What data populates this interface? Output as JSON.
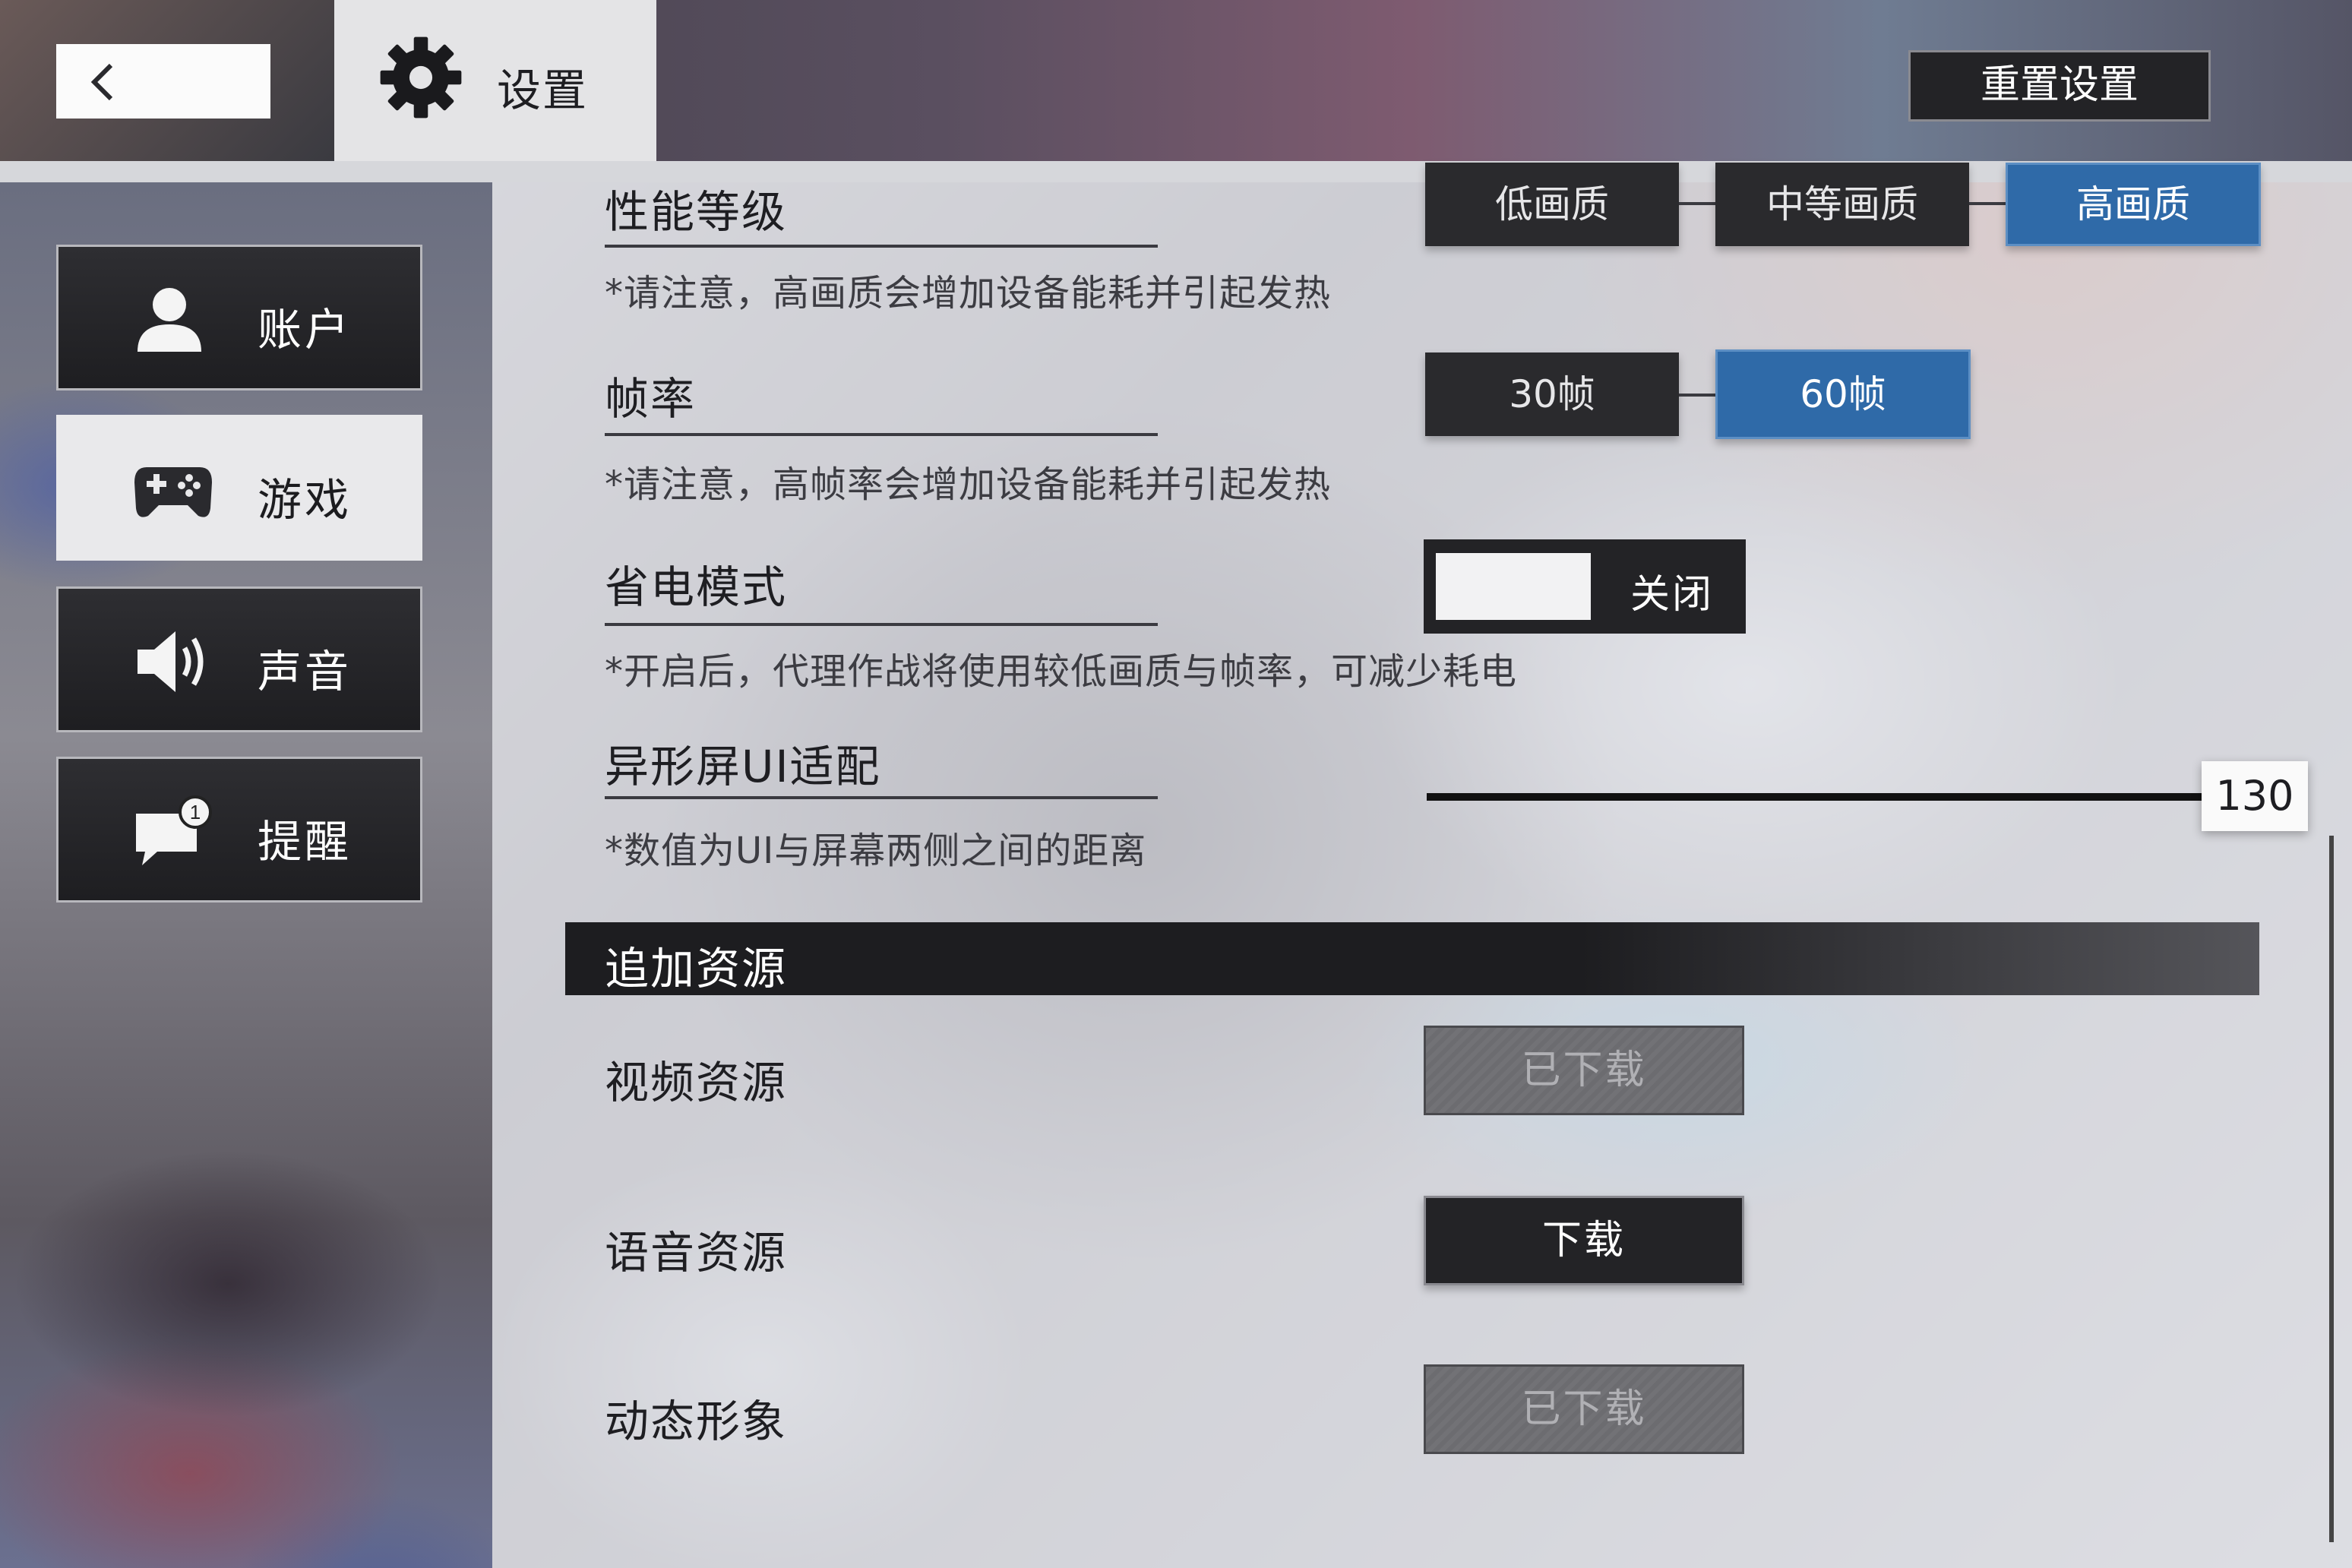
{
  "header": {
    "title": "设置",
    "reset_label": "重置设置"
  },
  "sidebar": {
    "items": [
      {
        "label": "账户",
        "icon": "user-icon",
        "active": false
      },
      {
        "label": "游戏",
        "icon": "gamepad-icon",
        "active": true
      },
      {
        "label": "声音",
        "icon": "speaker-icon",
        "active": false
      },
      {
        "label": "提醒",
        "icon": "message-notification-icon",
        "active": false
      }
    ]
  },
  "settings": {
    "performance": {
      "title": "性能等级",
      "note": "*请注意，高画质会增加设备能耗并引起发热",
      "options": [
        "低画质",
        "中等画质",
        "高画质"
      ],
      "selected": "高画质"
    },
    "framerate": {
      "title": "帧率",
      "note": "*请注意，高帧率会增加设备能耗并引起发热",
      "options": [
        "30帧",
        "60帧"
      ],
      "selected": "60帧"
    },
    "power_saving": {
      "title": "省电模式",
      "note": "*开启后，代理作战将使用较低画质与帧率，可减少耗电",
      "state_label": "关闭"
    },
    "notch_ui": {
      "title": "异形屏UI适配",
      "note": "*数值为UI与屏幕两侧之间的距离",
      "value": "130"
    }
  },
  "resources": {
    "section_title": "追加资源",
    "items": [
      {
        "label": "视频资源",
        "button": "已下载",
        "downloaded": true
      },
      {
        "label": "语音资源",
        "button": "下载",
        "downloaded": false
      },
      {
        "label": "动态形象",
        "button": "已下载",
        "downloaded": true
      }
    ]
  },
  "colors": {
    "accent_selected": "#2f6aa8",
    "button_dark": "#232326"
  }
}
